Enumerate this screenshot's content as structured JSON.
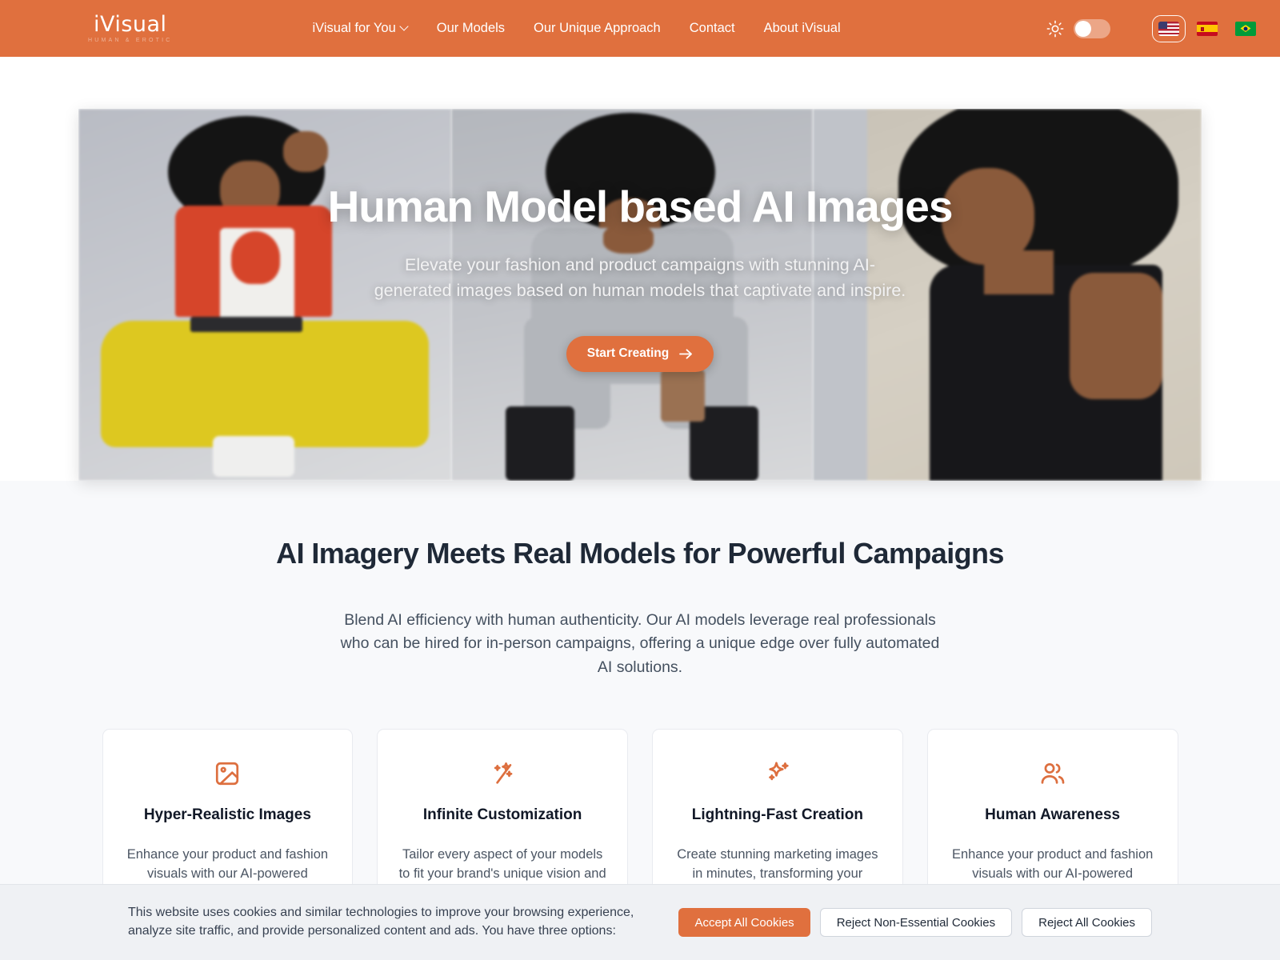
{
  "header": {
    "logo": {
      "name": "iVisual",
      "tagline": "HUMAN & EROTIC"
    },
    "nav": [
      {
        "label": "iVisual for You",
        "has_caret": true
      },
      {
        "label": "Our Models",
        "has_caret": false
      },
      {
        "label": "Our Unique Approach",
        "has_caret": false
      },
      {
        "label": "Contact",
        "has_caret": false
      },
      {
        "label": "About iVisual",
        "has_caret": false
      }
    ],
    "theme_toggle": {
      "icon": "sun-icon",
      "state": "off"
    },
    "languages": [
      {
        "code": "US",
        "label": "English",
        "selected": true
      },
      {
        "code": "ES",
        "label": "Espanol",
        "selected": false
      },
      {
        "code": "BR",
        "label": "Portugues",
        "selected": false
      }
    ],
    "accent_color": "#e0703e"
  },
  "hero": {
    "title": "Human Model based AI Images",
    "subtitle": "Elevate your fashion and product campaigns with stunning AI-generated images based on human models that captivate and inspire.",
    "cta_label": "Start Creating",
    "cta_icon": "arrow-right-icon"
  },
  "section": {
    "title": "AI Imagery Meets Real Models for Powerful Campaigns",
    "subtitle": "Blend AI efficiency with human authenticity. Our AI models leverage real professionals who can be hired for in-person campaigns, offering a unique edge over fully automated AI solutions.",
    "cards": [
      {
        "icon": "image-icon",
        "title": "Hyper-Realistic Images",
        "desc": "Enhance your product and fashion visuals with our AI-powered services, featuring real human"
      },
      {
        "icon": "magic-wand-icon",
        "title": "Infinite Customization",
        "desc": "Tailor every aspect of your models to fit your brand's unique vision and aesthetic preferences."
      },
      {
        "icon": "sparkles-icon",
        "title": "Lightning-Fast Creation",
        "desc": "Create stunning marketing images in minutes, transforming your creative process."
      },
      {
        "icon": "users-icon",
        "title": "Human Awareness",
        "desc": "Enhance your product and fashion visuals with our AI-powered services, featuring real human"
      }
    ]
  },
  "cookie_banner": {
    "text": "This website uses cookies and similar technologies to improve your browsing experience, analyze site traffic, and provide personalized content and ads. You have three options:",
    "accept_label": "Accept All Cookies",
    "reject_non_essential_label": "Reject Non-Essential Cookies",
    "reject_all_label": "Reject All Cookies"
  }
}
